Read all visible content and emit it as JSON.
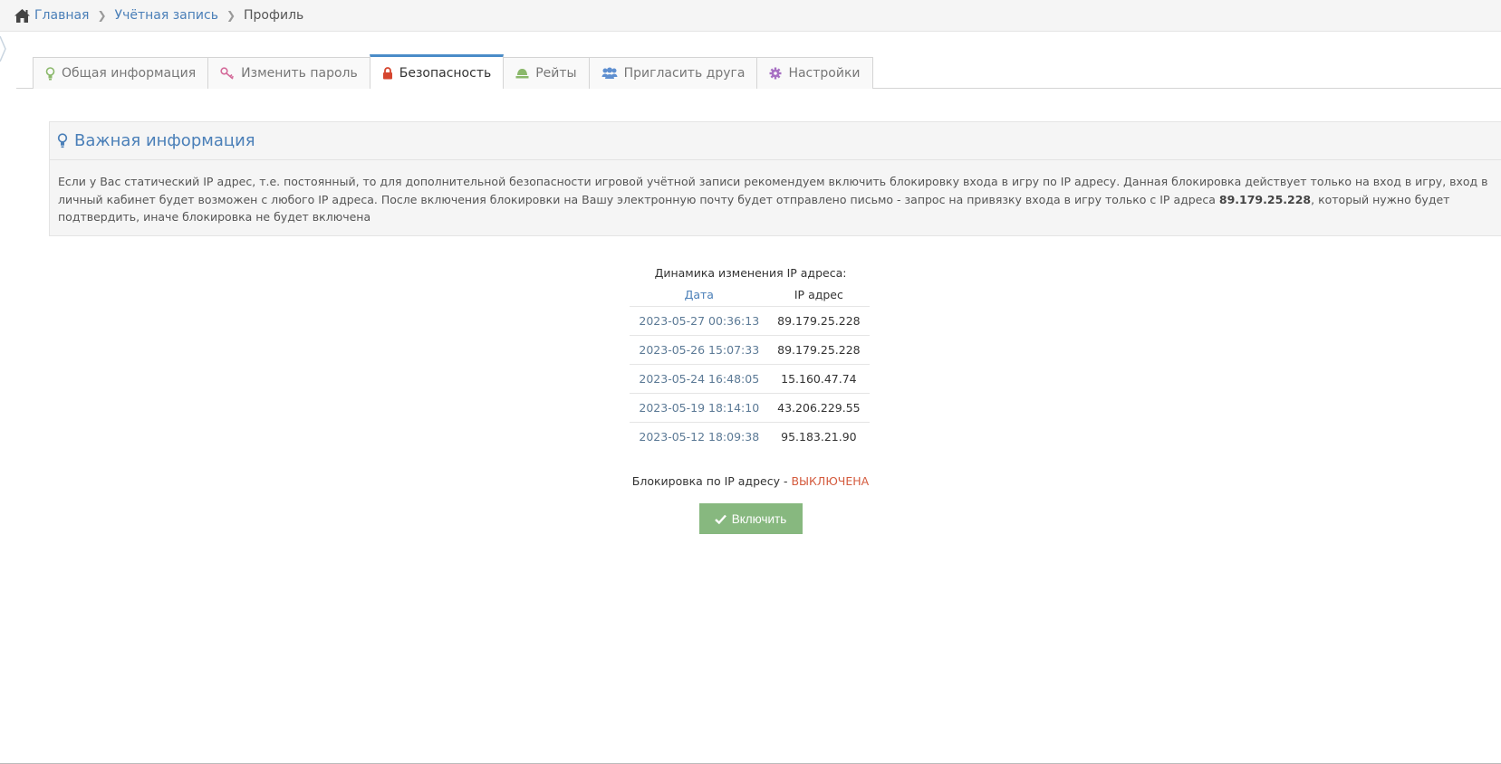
{
  "breadcrumb": {
    "home": "Главная",
    "account": "Учётная запись",
    "current": "Профиль"
  },
  "tabs": [
    {
      "label": "Общая информация",
      "icon": "lightbulb-icon"
    },
    {
      "label": "Изменить пароль",
      "icon": "key-icon"
    },
    {
      "label": "Безопасность",
      "icon": "lock-icon",
      "active": true
    },
    {
      "label": "Рейты",
      "icon": "rates-icon"
    },
    {
      "label": "Пригласить друга",
      "icon": "users-icon"
    },
    {
      "label": "Настройки",
      "icon": "gear-icon"
    }
  ],
  "info": {
    "title": "Важная информация",
    "text_before": "Если у Вас статический IP адрес, т.е. постоянный, то для дополнительной безопасности игровой учётной записи рекомендуем включить блокировку входа в игру по IP адресу. Данная блокировка действует только на вход в игру, вход в личный кабинет будет возможен с любого IP адреса. После включения блокировки на Вашу электронную почту будет отправлено письмо - запрос на привязку входа в игру только с IP адреса ",
    "ip": "89.179.25.228",
    "text_after": ", который нужно будет подтвердить, иначе блокировка не будет включена"
  },
  "ip_history": {
    "caption": "Динамика изменения IP адреса:",
    "col_date": "Дата",
    "col_ip": "IP адрес",
    "rows": [
      {
        "date": "2023-05-27 00:36:13",
        "ip": "89.179.25.228"
      },
      {
        "date": "2023-05-26 15:07:33",
        "ip": "89.179.25.228"
      },
      {
        "date": "2023-05-24 16:48:05",
        "ip": "15.160.47.74"
      },
      {
        "date": "2023-05-19 18:14:10",
        "ip": "43.206.229.55"
      },
      {
        "date": "2023-05-12 18:09:38",
        "ip": "95.183.21.90"
      }
    ]
  },
  "lock_status": {
    "label": "Блокировка по IP адресу - ",
    "value": "ВЫКЛЮЧЕНА"
  },
  "enable_button": "Включить",
  "colors": {
    "link": "#4a7fb8",
    "status_off": "#d45b3e",
    "button": "#87b87f",
    "active_tab_border": "#4a8cc8"
  }
}
